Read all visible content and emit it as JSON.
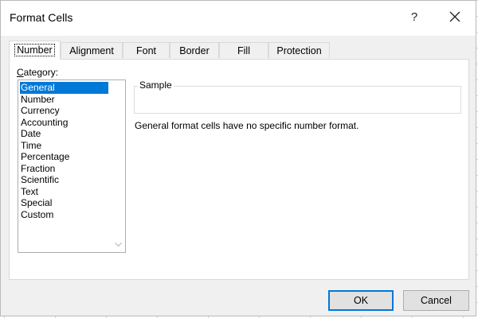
{
  "window": {
    "title": "Format Cells",
    "help_glyph": "?",
    "close_icon": "close-icon"
  },
  "tabs": [
    {
      "label": "Number",
      "active": true
    },
    {
      "label": "Alignment",
      "active": false
    },
    {
      "label": "Font",
      "active": false
    },
    {
      "label": "Border",
      "active": false
    },
    {
      "label": "Fill",
      "active": false
    },
    {
      "label": "Protection",
      "active": false
    }
  ],
  "number": {
    "category_label": "Category:",
    "category_label_accel": "C",
    "category_label_rest": "ategory:",
    "categories": [
      "General",
      "Number",
      "Currency",
      "Accounting",
      "Date",
      "Time",
      "Percentage",
      "Fraction",
      "Scientific",
      "Text",
      "Special",
      "Custom"
    ],
    "selected_category": "General",
    "sample_label": "Sample",
    "sample_value": "",
    "description": "General format cells have no specific number format."
  },
  "buttons": {
    "ok_label": "OK",
    "cancel_label": "Cancel"
  },
  "colors": {
    "selection": "#0078d7",
    "dialog_bg": "#f0f0f0"
  }
}
